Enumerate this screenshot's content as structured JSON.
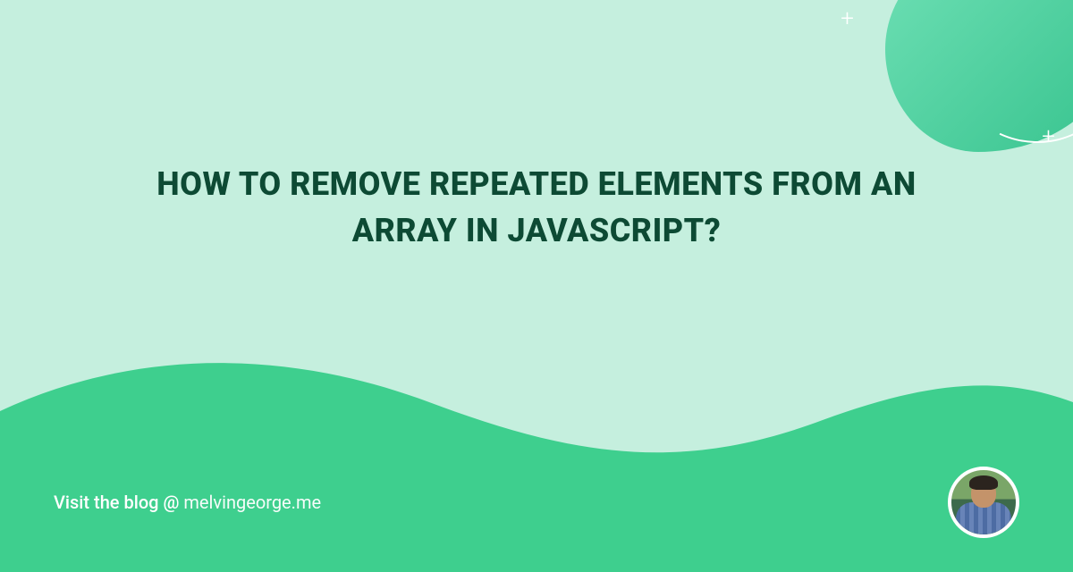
{
  "title": "HOW TO REMOVE REPEATED ELEMENTS FROM AN ARRAY IN JAVASCRIPT?",
  "footer": {
    "prefix": "Visit the blog @ ",
    "domain": "melvingeorge.me"
  },
  "colors": {
    "bg_light": "#c5efde",
    "accent": "#3ecf8e",
    "text_dark": "#0d4a34"
  }
}
